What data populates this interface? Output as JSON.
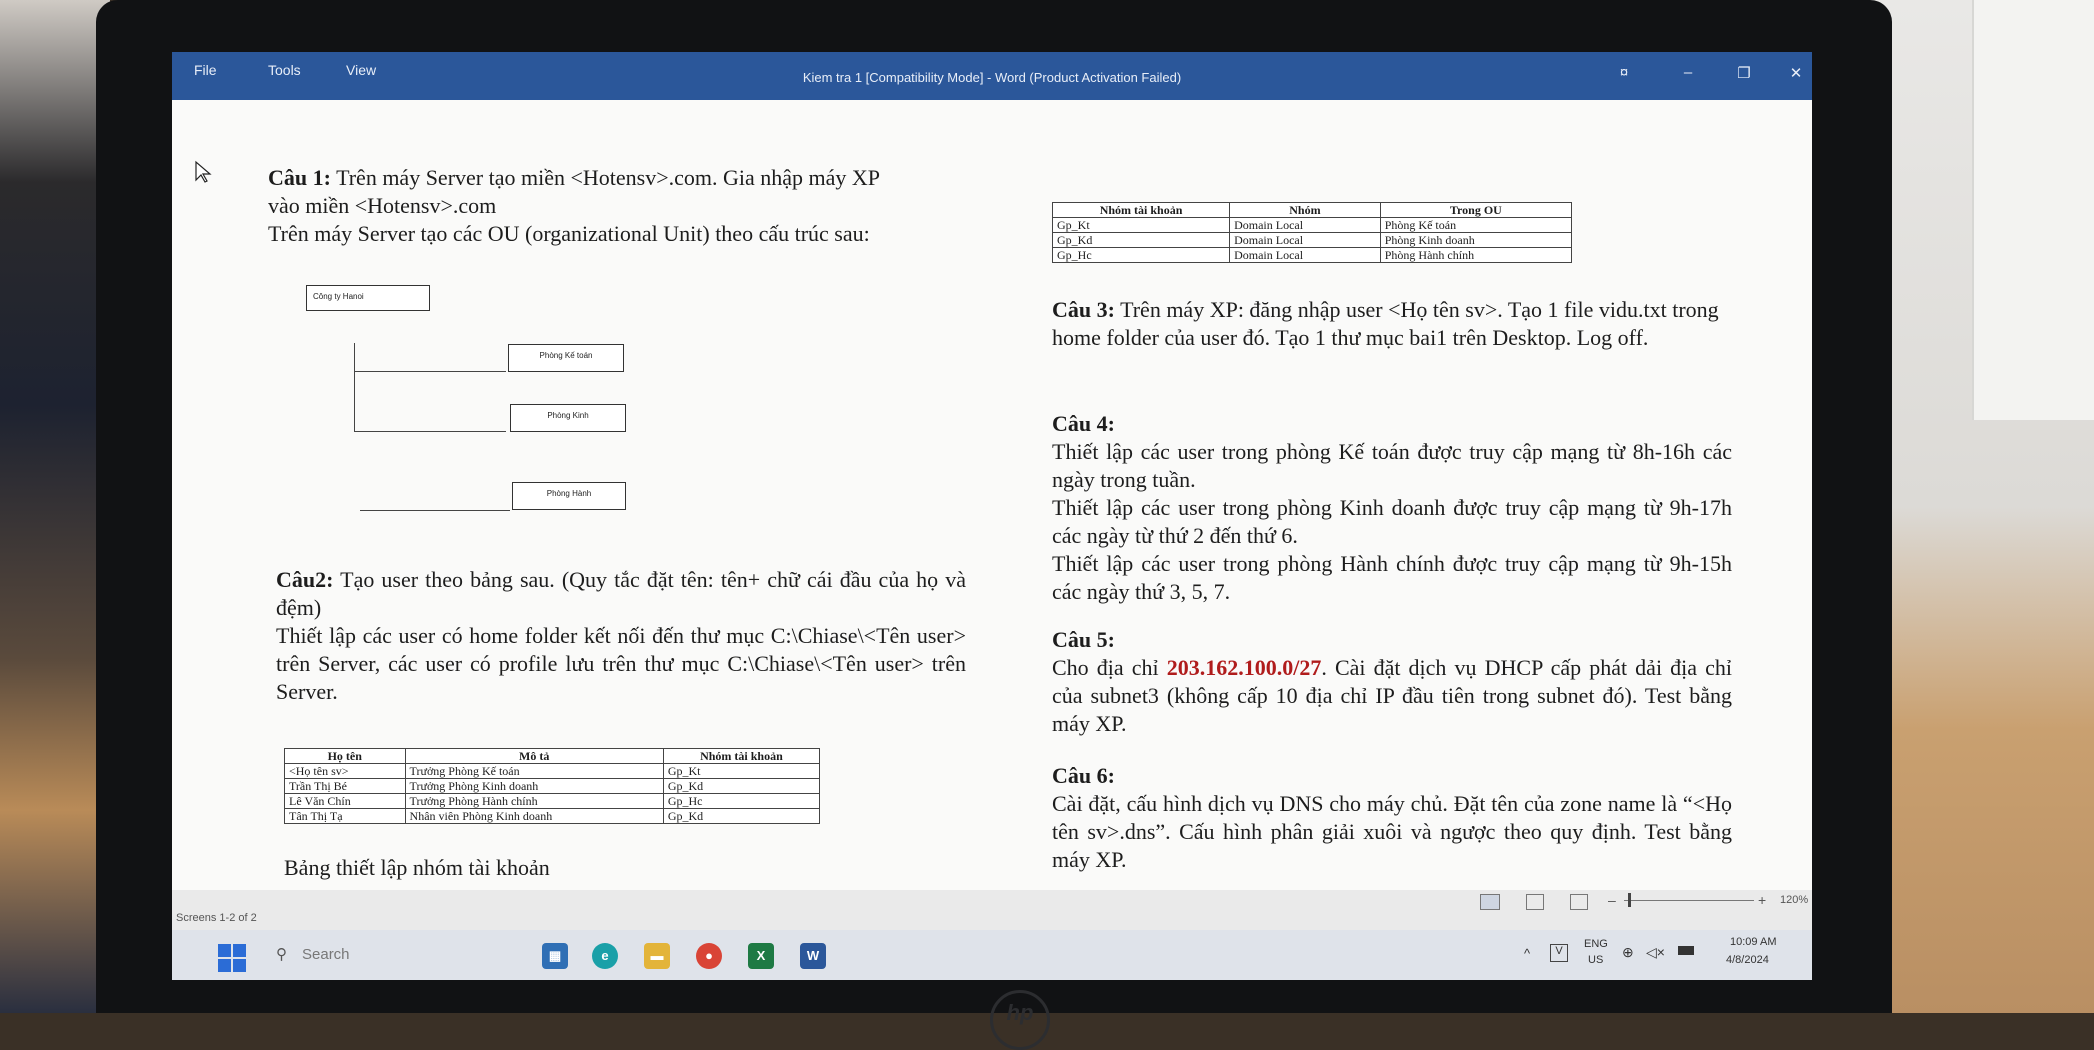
{
  "window": {
    "menu": [
      "File",
      "Tools",
      "View"
    ],
    "title": "Kiem tra 1 [Compatibility Mode] - Word (Product Activation Failed)",
    "controls": [
      "¤",
      "–",
      "❐",
      "✕"
    ]
  },
  "left_column": {
    "q1_label": "Câu 1:",
    "q1_text": "Trên máy Server tạo miền <Hotensv>.com. Gia nhập máy XP vào miền <Hotensv>.com",
    "q1_text2": "Trên máy Server tạo các OU (organizational Unit) theo cấu trúc sau:",
    "ou_root": "Công ty Hanoi",
    "ou_children": [
      "Phòng Kế toán",
      "Phòng Kinh",
      "Phòng Hành"
    ],
    "q2_label": "Câu2:",
    "q2_text": "Tạo user theo bảng sau. (Quy tắc đặt tên: tên+ chữ cái đầu của họ và đệm)",
    "q2_text2": "Thiết lập các user có home folder kết nối đến thư mục C:\\Chiase\\<Tên user> trên Server, các user có profile lưu trên thư mục C:\\Chiase\\<Tên user> trên Server.",
    "user_table": {
      "headers": [
        "Họ tên",
        "Mô tả",
        "Nhóm tài khoản"
      ],
      "rows": [
        [
          "<Họ tên sv>",
          "Trưởng Phòng Kế toán",
          "Gp_Kt"
        ],
        [
          "Trần Thị Bé",
          "Trưởng Phòng Kinh doanh",
          "Gp_Kd"
        ],
        [
          "Lê Văn Chín",
          "Trưởng Phòng Hành chính",
          "Gp_Hc"
        ],
        [
          "Tân Thị Tạ",
          "Nhân viên Phòng Kinh doanh",
          "Gp_Kd"
        ]
      ]
    },
    "table_caption": "Bảng thiết lập nhóm tài khoản"
  },
  "right_column": {
    "group_table": {
      "headers": [
        "Nhóm tài khoản",
        "Nhóm",
        "Trong OU"
      ],
      "rows": [
        [
          "Gp_Kt",
          "Domain Local",
          "Phòng Kế toán"
        ],
        [
          "Gp_Kd",
          "Domain Local",
          "Phòng Kinh doanh"
        ],
        [
          "Gp_Hc",
          "Domain Local",
          "Phòng Hành chính"
        ]
      ]
    },
    "q3_label": "Câu 3:",
    "q3_text": "Trên máy XP: đăng nhập user <Họ tên sv>. Tạo 1 file vidu.txt trong home folder của user đó. Tạo 1 thư mục bai1 trên Desktop. Log off.",
    "q4_label": "Câu 4:",
    "q4_lines": [
      "Thiết lập các user trong phòng Kế toán được truy cập mạng từ 8h-16h các ngày trong tuần.",
      "Thiết lập các user trong phòng Kinh doanh được truy cập mạng từ 9h-17h các ngày từ thứ 2 đến thứ 6.",
      "Thiết lập các user trong phòng Hành chính được truy cập mạng từ 9h-15h các ngày thứ 3, 5, 7."
    ],
    "q5_label": "Câu 5:",
    "q5_pre": "Cho địa chỉ ",
    "q5_ip": "203.162.100.0/27",
    "q5_post": ". Cài đặt dịch vụ DHCP cấp phát dải địa chỉ của subnet3 (không cấp 10 địa chỉ IP đầu tiên trong subnet đó). Test bằng máy XP.",
    "q6_label": "Câu 6:",
    "q6_text": "Cài đặt, cấu hình dịch vụ DNS cho máy chủ. Đặt tên của zone name là “<Họ tên sv>.dns”. Cấu hình phân giải xuôi và ngược theo quy định. Test bằng máy XP."
  },
  "status": {
    "screens": "Screens 1-2 of 2",
    "zoom": "120%",
    "zoom_minus": "–",
    "zoom_plus": "+"
  },
  "taskbar": {
    "search_placeholder": "Search",
    "lang_top": "ENG",
    "lang_bottom": "US",
    "time": "10:09 AM",
    "date": "4/8/2024"
  }
}
